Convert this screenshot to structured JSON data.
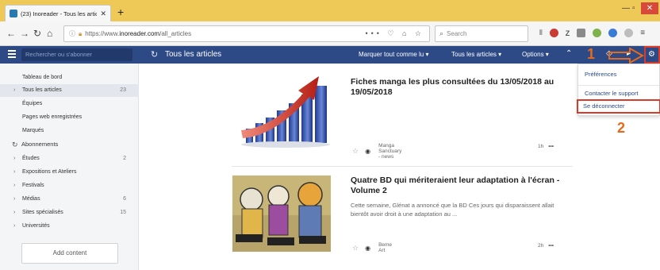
{
  "browser": {
    "tab_title": "(23) Inoreader - Tous les article",
    "url_prefix": "https://www.",
    "url_host": "inoreader.com",
    "url_path": "/all_articles",
    "url_actions": "••• ♡ ⌂ ☆",
    "search_placeholder": "Search",
    "new_tab_symbol": "+",
    "close_symbol": "✕"
  },
  "header": {
    "search_placeholder": "Rechercher ou s'abonner",
    "feed_title": "Tous les articles",
    "mark_all_read": "Marquer tout comme lu",
    "all_articles_menu": "Tous les articles",
    "options_menu": "Options"
  },
  "annotations": {
    "step1": "1",
    "step2": "2"
  },
  "settings_menu": {
    "preferences": "Préférences",
    "contact_support": "Contacter le support",
    "logout": "Se déconnecter"
  },
  "sidebar": {
    "items": [
      {
        "label": "Tableau de bord",
        "count": ""
      },
      {
        "label": "Tous les articles",
        "count": "23"
      },
      {
        "label": "Équipes",
        "count": ""
      },
      {
        "label": "Pages web enregistrées",
        "count": ""
      },
      {
        "label": "Marqués",
        "count": ""
      }
    ],
    "subscriptions_label": "Abonnements",
    "folders": [
      {
        "label": "Études",
        "count": "2"
      },
      {
        "label": "Expositions et Ateliers",
        "count": ""
      },
      {
        "label": "Festivals",
        "count": ""
      },
      {
        "label": "Médias",
        "count": "6"
      },
      {
        "label": "Sites spécialisés",
        "count": "15"
      },
      {
        "label": "Universités",
        "count": ""
      }
    ],
    "add_content": "Add content"
  },
  "articles": [
    {
      "title": "Fiches manga les plus consultées du 13/05/2018 au 19/05/2018",
      "snippet": "",
      "source": "Manga Sanctuary - news",
      "age": "1h"
    },
    {
      "title": "Quatre BD qui mériteraient leur adaptation à l'écran - Volume 2",
      "snippet": "Cette semaine, Glénat a annoncé que la BD Ces jours qui disparaissent allait bientôt avoir droit à une adaptation au ...",
      "source": "Beme Art",
      "age": "2h"
    }
  ],
  "colors": {
    "tabbar": "#efc958",
    "app_header": "#2d4a86",
    "annotation_orange": "#e66a1c",
    "annotation_red": "#d83b2a"
  }
}
